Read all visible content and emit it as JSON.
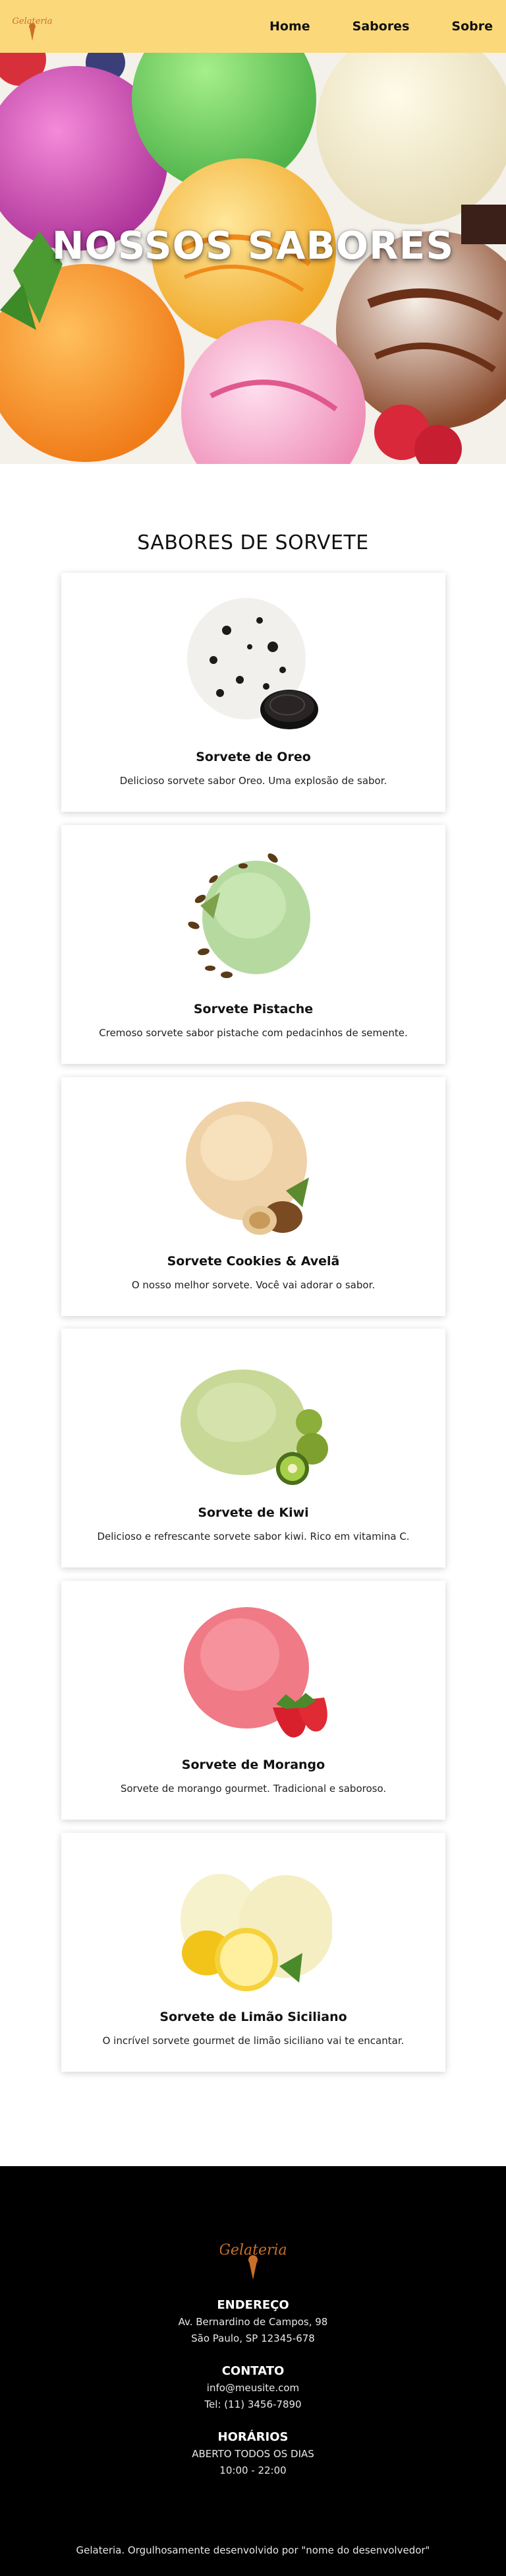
{
  "header": {
    "logo_text": "Gelateria",
    "nav": [
      {
        "label": "Home"
      },
      {
        "label": "Sabores"
      },
      {
        "label": "Sobre"
      }
    ]
  },
  "hero": {
    "title": "NOSSOS SABORES"
  },
  "section": {
    "title": "SABORES DE SORVETE"
  },
  "flavors": [
    {
      "name": "Sorvete de Oreo",
      "description": "Delicioso sorvete sabor Oreo. Uma explosão de sabor."
    },
    {
      "name": "Sorvete Pistache",
      "description": "Cremoso sorvete sabor pistache com pedacinhos de semente."
    },
    {
      "name": "Sorvete Cookies & Avelã",
      "description": "O nosso melhor sorvete. Você vai adorar o sabor."
    },
    {
      "name": "Sorvete de Kiwi",
      "description": "Delicioso e refrescante sorvete sabor kiwi. Rico em vitamina C."
    },
    {
      "name": "Sorvete de Morango",
      "description": "Sorvete de morango gourmet. Tradicional e saboroso."
    },
    {
      "name": "Sorvete de Limão Siciliano",
      "description": "O incrível sorvete gourmet de limão siciliano vai te encantar."
    }
  ],
  "footer": {
    "logo_text": "Gelateria",
    "address_heading": "ENDEREÇO",
    "address_line1": "Av. Bernardino de Campos, 98",
    "address_line2": "São Paulo, SP 12345-678",
    "contact_heading": "CONTATO",
    "contact_email": "info@meusite.com",
    "contact_phone": "Tel: (11) 3456-7890",
    "hours_heading": "HORÁRIOS",
    "hours_line1": "ABERTO TODOS OS DIAS",
    "hours_line2": "10:00 - 22:00",
    "copyright": "Gelateria. Orgulhosamente desenvolvido por \"nome do desenvolvedor\""
  },
  "colors": {
    "header_bg": "#fbd87a",
    "footer_bg": "#000000",
    "logo_accent": "#c8702a"
  }
}
